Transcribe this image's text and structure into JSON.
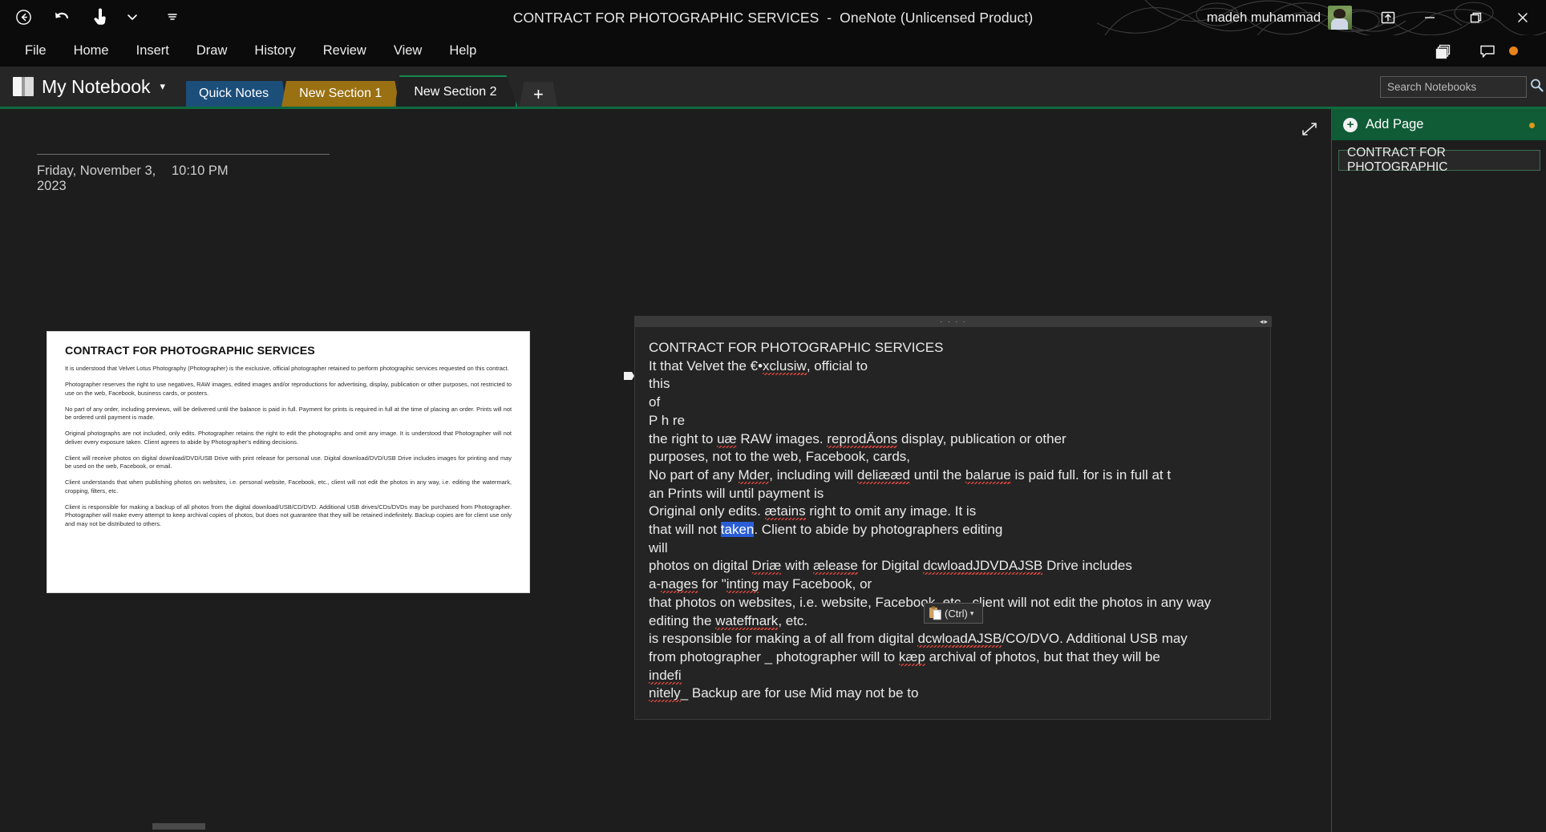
{
  "window": {
    "title": "CONTRACT FOR PHOTOGRAPHIC SERVICES  -  OneNote (Unlicensed Product)",
    "user_name": "madeh muhammad",
    "minimize_label": "—",
    "restore_label": "❐",
    "close_label": "✕"
  },
  "quick_access": {
    "back_icon": "back-arrow-circle-icon",
    "undo_icon": "undo-icon",
    "touch_icon": "touch-mode-icon",
    "more_icon": "customize-quick-access-icon"
  },
  "ribbon": {
    "tabs": [
      {
        "label": "File"
      },
      {
        "label": "Home"
      },
      {
        "label": "Insert"
      },
      {
        "label": "Draw"
      },
      {
        "label": "History"
      },
      {
        "label": "Review"
      },
      {
        "label": "View"
      },
      {
        "label": "Help"
      }
    ],
    "share_icon": "share-pages-icon",
    "comments_icon": "comments-icon"
  },
  "notebook": {
    "name": "My Notebook",
    "caret": "▾",
    "icon": "notebook-icon"
  },
  "sections": [
    {
      "label": "Quick Notes",
      "color": "#1c4e7a",
      "active": false
    },
    {
      "label": "New Section 1",
      "color": "#9a7112",
      "active": false
    },
    {
      "label": "New Section 2",
      "color": "#14884f",
      "active": true
    }
  ],
  "add_section_label": "+",
  "search": {
    "placeholder": "Search Notebooks",
    "value": "",
    "icon": "search-icon",
    "caret": "▾"
  },
  "page": {
    "expand_icon": "expand-page-icon",
    "date": "Friday, November 3, 2023",
    "time": "10:10 PM"
  },
  "contract_image": {
    "heading": "CONTRACT FOR PHOTOGRAPHIC SERVICES",
    "paragraphs": [
      "It is understood that Velvet Lotus Photography (Photographer) is the exclusive, official photographer retained to perform photographic services requested on this contract.",
      "Photographer reserves the right to use negatives, RAW images, edited images and/or reproductions for advertising, display, publication or other purposes, not restricted to use on the web, Facebook, business cards, or posters.",
      "No part of any order, including previews, will be delivered until the balance is paid in full. Payment for prints is required in full at the time of placing an order. Prints will not be ordered until payment is made.",
      "Original photographs are not included, only edits. Photographer retains the right to edit the photographs and omit any image. It is understood that Photographer will not deliver every exposure taken. Client agrees to abide by Photographer's editing decisions.",
      "Client will receive photos on digital download/DVD/USB Drive with print release for personal use. Digital download/DVD/USB Drive includes images for printing and may be used on the web, Facebook, or email.",
      "Client understands that when publishing photos on websites, i.e. personal website, Facebook, etc., client will not edit the photos in any way, i.e. editing the watermark, cropping, filters, etc.",
      "Client is responsible for making a backup of all photos from the digital download/USB/CD/DVD. Additional USB drives/CDs/DVDs may be purchased from Photographer. Photographer will make every attempt to keep archival copies of photos, but does not guarantee that they will be retained indefinitely. Backup copies are for client use only and may not be distributed to others."
    ]
  },
  "pasted_text": {
    "handle_dots": "· · · ·",
    "handle_arrows": "◂▸",
    "lines": [
      {
        "text": "CONTRACT FOR PHOTOGRAPHIC SERVICES"
      },
      {
        "text": "It that Velvet the €•xclusiw, official to",
        "misspelled": "xclusiw"
      },
      {
        "text": "this"
      },
      {
        "text": "of"
      },
      {
        "text": "P h re"
      },
      {
        "text": "the right to uæ RAW images. reprodÄons display, publication or other",
        "misspelled": "uæ|reprodÄons"
      },
      {
        "text": "purposes, not to the web, Facebook, cards,"
      },
      {
        "text": "No part of any Mder, including will deliææd until the balarue is paid full. for is in full at t",
        "misspelled": "Mder|deliææd|balarue"
      },
      {
        "text": "an Prints will until payment is"
      },
      {
        "text": "Original only edits. ætains right to omit any image. It is",
        "misspelled": "ætains"
      },
      {
        "text": "that will not taken. Client to abide by photographers editing",
        "selected": "taken"
      },
      {
        "text": "will"
      },
      {
        "text": "photos on digital Driæ with ælease for Digital dcwloadJDVDAJSB Drive includes",
        "misspelled": "Driæ|ælease|dcwloadJDVDAJSB"
      },
      {
        "text": "a-nages for \"inting may Facebook, or",
        "misspelled": "nages|inting"
      },
      {
        "text": "that photos on websites, i.e. website, Facebook, etc., client will not edit the photos in any way"
      },
      {
        "text": "editing the wateffnark, etc.",
        "misspelled": "wateffnark"
      },
      {
        "text": "is responsible for making a of all from digital dcwloadAJSB/CO/DVO. Additional USB may",
        "misspelled": "dcwloadAJSB"
      },
      {
        "text": "from photographer _ photographer will to kæp archival of photos, but that they will be",
        "misspelled": "kæp"
      },
      {
        "text": "indefi",
        "misspelled": "indefi"
      },
      {
        "text": "nitely_ Backup are for use Mid may not be to",
        "misspelled": "nitely"
      }
    ]
  },
  "paste_options": {
    "label": "(Ctrl)",
    "caret": "▾",
    "icon": "clipboard-paste-icon"
  },
  "page_panel": {
    "add_page_label": "Add Page",
    "add_page_icon": "plus-circle-icon",
    "pages": [
      {
        "title": "CONTRACT FOR PHOTOGRAPHIC"
      }
    ]
  },
  "colors": {
    "accent_green": "#0f6a3f",
    "section_blue": "#1c4e7a",
    "section_gold": "#9a7112",
    "section_active": "#14884f",
    "amber_dot": "#e8821a",
    "spell_error": "#d9453d",
    "selection": "#2a5ed6"
  }
}
